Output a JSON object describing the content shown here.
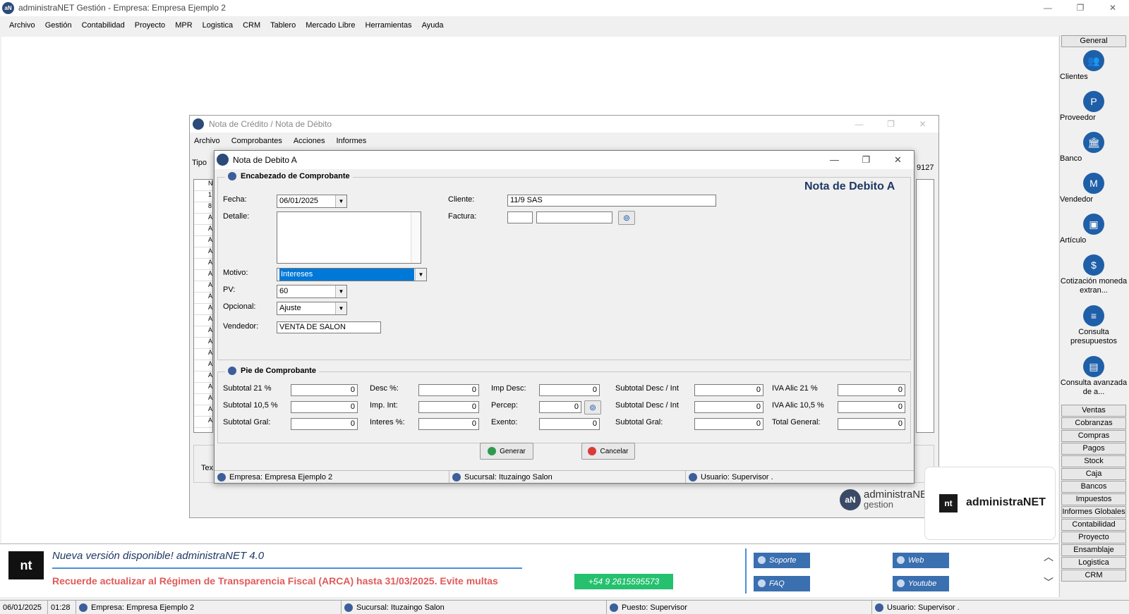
{
  "app": {
    "title": "administraNET Gestión - Empresa: Empresa Ejemplo 2",
    "icon": "app-logo-icon"
  },
  "window_controls": {
    "minimize": "—",
    "restore": "❐",
    "close": "✕"
  },
  "menu": [
    "Archivo",
    "Gestión",
    "Contabilidad",
    "Proyecto",
    "MPR",
    "Logistica",
    "CRM",
    "Tablero",
    "Mercado Libre",
    "Herramientas",
    "Ayuda"
  ],
  "sidebar": {
    "header": "General",
    "items": [
      {
        "label": "Clientes",
        "icon": "clients-icon"
      },
      {
        "label": "Proveedor",
        "icon": "provider-icon"
      },
      {
        "label": "Banco",
        "icon": "bank-icon"
      },
      {
        "label": "Vendedor",
        "icon": "seller-icon"
      },
      {
        "label": "Artículo",
        "icon": "box-icon"
      },
      {
        "label": "Cotización moneda extran...",
        "icon": "currency-icon"
      },
      {
        "label": "Consulta presupuestos",
        "icon": "document-icon"
      },
      {
        "label": "Consulta avanzada de a...",
        "icon": "advanced-search-icon"
      }
    ],
    "buttons": [
      "Ventas",
      "Cobranzas",
      "Compras",
      "Pagos",
      "Stock",
      "Caja",
      "Bancos",
      "Impuestos",
      "Informes Globales",
      "Contabilidad",
      "Proyecto",
      "Ensamblaje",
      "Logistica",
      "CRM"
    ]
  },
  "outer_dialog": {
    "title": "Nota de Crédito / Nota de Débito",
    "menu": [
      "Archivo",
      "Comprobantes",
      "Acciones",
      "Informes"
    ],
    "tipo_label": "Tipo",
    "right_text": "9127",
    "grid_rows": [
      "N",
      "1",
      "8",
      "A",
      "A",
      "A",
      "A",
      "A",
      "A",
      "A",
      "A",
      "A",
      "A",
      "A",
      "A",
      "A",
      "A",
      "A",
      "A",
      "A",
      "A",
      "A"
    ],
    "bottom_label": "Tex"
  },
  "inner_dialog": {
    "title": "Nota de Debito A",
    "heading": "Nota de Debito A",
    "header_group": "Encabezado de Comprobante",
    "fecha_label": "Fecha:",
    "fecha_value": "06/01/2025",
    "detalle_label": "Detalle:",
    "motivo_label": "Motivo:",
    "motivo_value": "Intereses",
    "pv_label": "PV:",
    "pv_value": "60",
    "opcional_label": "Opcional:",
    "opcional_value": "Ajuste",
    "vendedor_label": "Vendedor:",
    "vendedor_value": "VENTA DE SALON",
    "cliente_label": "Cliente:",
    "cliente_value": "11/9 SAS",
    "factura_label": "Factura:",
    "footer_group": "Pie de Comprobante",
    "footer": {
      "subtotal21_label": "Subtotal  21 %",
      "subtotal21": "0",
      "subtotal105_label": "Subtotal  10,5 %",
      "subtotal105": "0",
      "subtotalgral_label": "Subtotal Gral:",
      "subtotalgral": "0",
      "desc_label": "Desc %:",
      "desc": "0",
      "impint_label": "Imp. Int:",
      "impint": "0",
      "interes_label": "Interes %:",
      "interes": "0",
      "impdesc_label": "Imp Desc:",
      "impdesc": "0",
      "percep_label": "Percep:",
      "percep": "0",
      "exento_label": "Exento:",
      "exento": "0",
      "subdesc1_label": "Subtotal Desc / Int",
      "subdesc1": "0",
      "subdesc2_label": "Subtotal Desc / Int",
      "subdesc2": "0",
      "subgral2_label": "Subtotal Gral:",
      "subgral2": "0",
      "iva21_label": "IVA Alic   21 %",
      "iva21": "0",
      "iva105_label": "IVA Alic  10,5 %",
      "iva105": "0",
      "total_label": "Total General:",
      "total": "0"
    },
    "generar": "Generar",
    "cancelar": "Cancelar",
    "status": {
      "empresa": "Empresa: Empresa Ejemplo 2",
      "sucursal": "Sucursal: Ituzaingo Salon",
      "usuario": "Usuario: Supervisor ."
    }
  },
  "logos": {
    "gestion_top": "administraNET",
    "gestion_bottom": "gestion",
    "mark": "aN",
    "box_mark": "nt",
    "box_name": "administraNET"
  },
  "news": {
    "mark": "nt",
    "headline": "Nueva versión disponible! administraNET 4.0",
    "reminder": "Recuerde actualizar al Régimen de Transparencia Fiscal (ARCA) hasta 31/03/2025. Evite multas",
    "whatsapp": "+54 9 2615595573",
    "soporte": "Soporte",
    "web": "Web",
    "faq": "FAQ",
    "youtube": "Youtube",
    "up": "︿",
    "down": "﹀"
  },
  "bottom_status": {
    "date": "06/01/2025",
    "time": "01:28",
    "empresa": "Empresa: Empresa Ejemplo 2",
    "sucursal": "Sucursal: Ituzaingo Salon",
    "puesto": "Puesto: Supervisor",
    "usuario": "Usuario: Supervisor ."
  },
  "colors": {
    "accent": "#1f5fa8",
    "heading": "#1f3864",
    "reminder": "#e05a5a",
    "whatsapp": "#25c16f",
    "selection": "#0078d7"
  }
}
